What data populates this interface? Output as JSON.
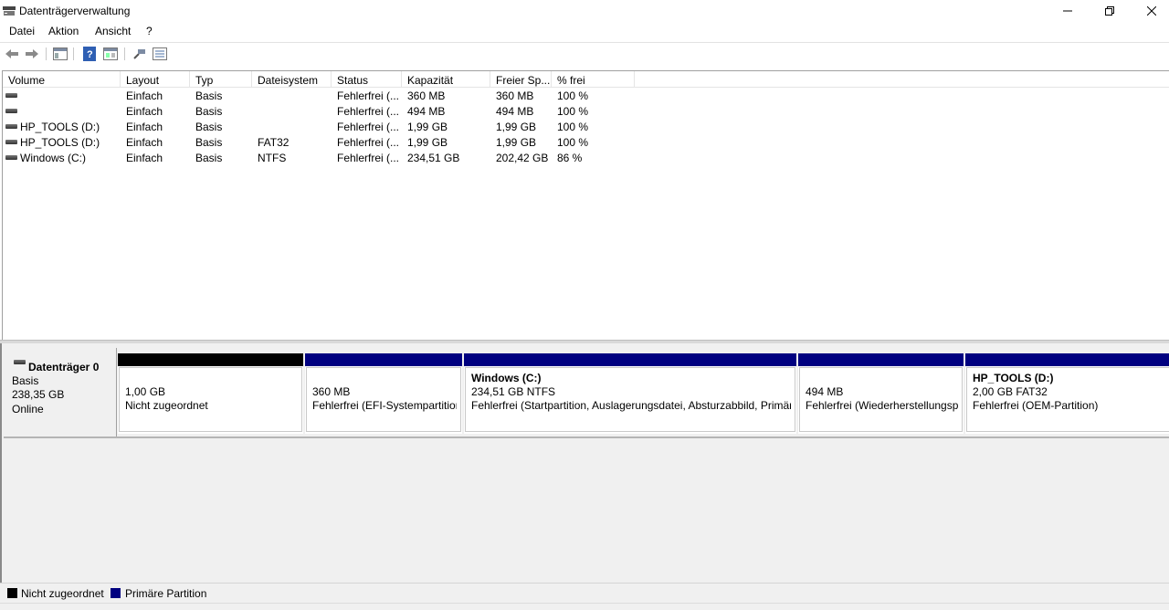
{
  "window": {
    "title": "Datenträgerverwaltung"
  },
  "menu": {
    "items": [
      "Datei",
      "Aktion",
      "Ansicht",
      "?"
    ]
  },
  "toolbar": {
    "icons": [
      "back-icon",
      "forward-icon",
      "console-tree-icon",
      "help-icon",
      "properties-icon",
      "connect-icon",
      "list-view-icon"
    ]
  },
  "volume_list": {
    "columns": [
      "Volume",
      "Layout",
      "Typ",
      "Dateisystem",
      "Status",
      "Kapazität",
      "Freier Sp...",
      "% frei"
    ],
    "rows": [
      {
        "volume": "",
        "layout": "Einfach",
        "typ": "Basis",
        "dateisystem": "",
        "status": "Fehlerfrei (...",
        "kapazitaet": "360 MB",
        "frei": "360 MB",
        "prozent": "100 %"
      },
      {
        "volume": "",
        "layout": "Einfach",
        "typ": "Basis",
        "dateisystem": "",
        "status": "Fehlerfrei (...",
        "kapazitaet": "494 MB",
        "frei": "494 MB",
        "prozent": "100 %"
      },
      {
        "volume": "HP_TOOLS (D:)",
        "layout": "Einfach",
        "typ": "Basis",
        "dateisystem": "",
        "status": "Fehlerfrei (...",
        "kapazitaet": "1,99 GB",
        "frei": "1,99 GB",
        "prozent": "100 %"
      },
      {
        "volume": "HP_TOOLS (D:)",
        "layout": "Einfach",
        "typ": "Basis",
        "dateisystem": "FAT32",
        "status": "Fehlerfrei (...",
        "kapazitaet": "1,99 GB",
        "frei": "1,99 GB",
        "prozent": "100 %"
      },
      {
        "volume": "Windows (C:)",
        "layout": "Einfach",
        "typ": "Basis",
        "dateisystem": "NTFS",
        "status": "Fehlerfrei (...",
        "kapazitaet": "234,51 GB",
        "frei": "202,42 GB",
        "prozent": "86 %"
      }
    ]
  },
  "disk": {
    "name": "Datenträger 0",
    "type": "Basis",
    "size": "238,35 GB",
    "state": "Online",
    "partitions": [
      {
        "title": "",
        "size": "1,00 GB",
        "status": "Nicht zugeordnet",
        "bar_color": "#000000"
      },
      {
        "title": "",
        "size": "360 MB",
        "status": "Fehlerfrei (EFI-Systempartition)",
        "bar_color": "#000080"
      },
      {
        "title": "Windows  (C:)",
        "size": "234,51 GB NTFS",
        "status": "Fehlerfrei (Startpartition, Auslagerungsdatei, Absturzabbild, Primäre Partition)",
        "bar_color": "#000080"
      },
      {
        "title": "",
        "size": "494 MB",
        "status": "Fehlerfrei (Wiederherstellungspartition)",
        "bar_color": "#000080"
      },
      {
        "title": "HP_TOOLS  (D:)",
        "size": "2,00 GB FAT32",
        "status": "Fehlerfrei (OEM-Partition)",
        "bar_color": "#000080"
      }
    ]
  },
  "legend": [
    {
      "label": "Nicht zugeordnet",
      "color": "#000000"
    },
    {
      "label": "Primäre Partition",
      "color": "#000080"
    }
  ]
}
